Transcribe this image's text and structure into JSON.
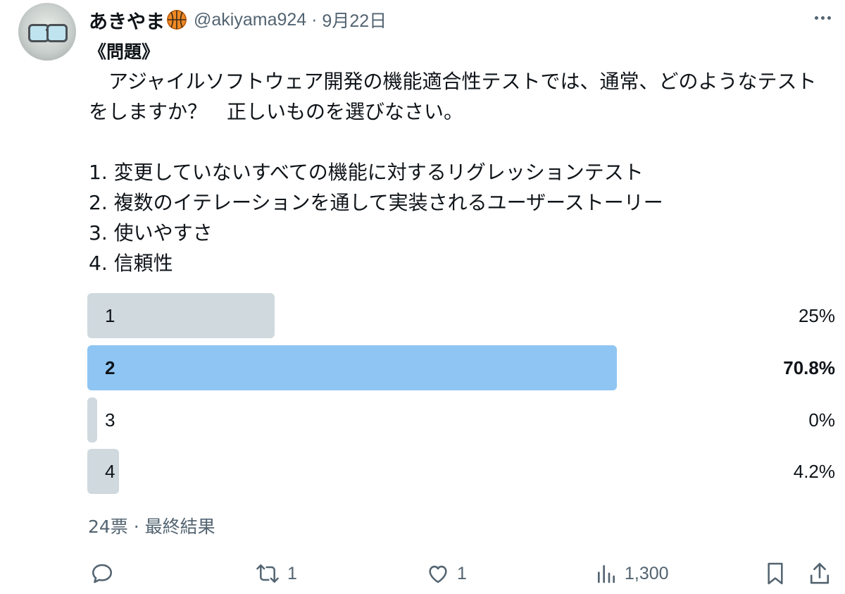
{
  "post": {
    "display_name": "あきやま",
    "handle": "@akiyama924",
    "separator": "·",
    "date": "9月22日",
    "title": "《問題》",
    "body": "　アジャイルソフトウェア開発の機能適合性テストでは、通常、どのようなテストをしますか？　正しいものを選びなさい。\n\n1. 変更していないすべての機能に対するリグレッションテスト\n2. 複数のイテレーションを通して実装されるユーザーストーリー\n3. 使いやすさ\n4. 信頼性"
  },
  "poll": {
    "options": [
      {
        "label": "1",
        "percent_text": "25%",
        "percent": 25.0,
        "winner": false
      },
      {
        "label": "2",
        "percent_text": "70.8%",
        "percent": 70.8,
        "winner": true
      },
      {
        "label": "3",
        "percent_text": "0%",
        "percent": 0.0,
        "winner": false
      },
      {
        "label": "4",
        "percent_text": "4.2%",
        "percent": 4.2,
        "winner": false
      }
    ],
    "meta": "24票 · 最終結果"
  },
  "actions": {
    "reply_count": "",
    "repost_count": "1",
    "like_count": "1",
    "views_count": "1,300"
  },
  "colors": {
    "winner_bar": "#8ec5f2",
    "loser_bar": "#cfd9de",
    "muted": "#536471",
    "orange": "#f08a24"
  },
  "icons": [
    "more-icon",
    "reply-icon",
    "repost-icon",
    "like-icon",
    "views-icon",
    "bookmark-icon",
    "share-icon"
  ]
}
